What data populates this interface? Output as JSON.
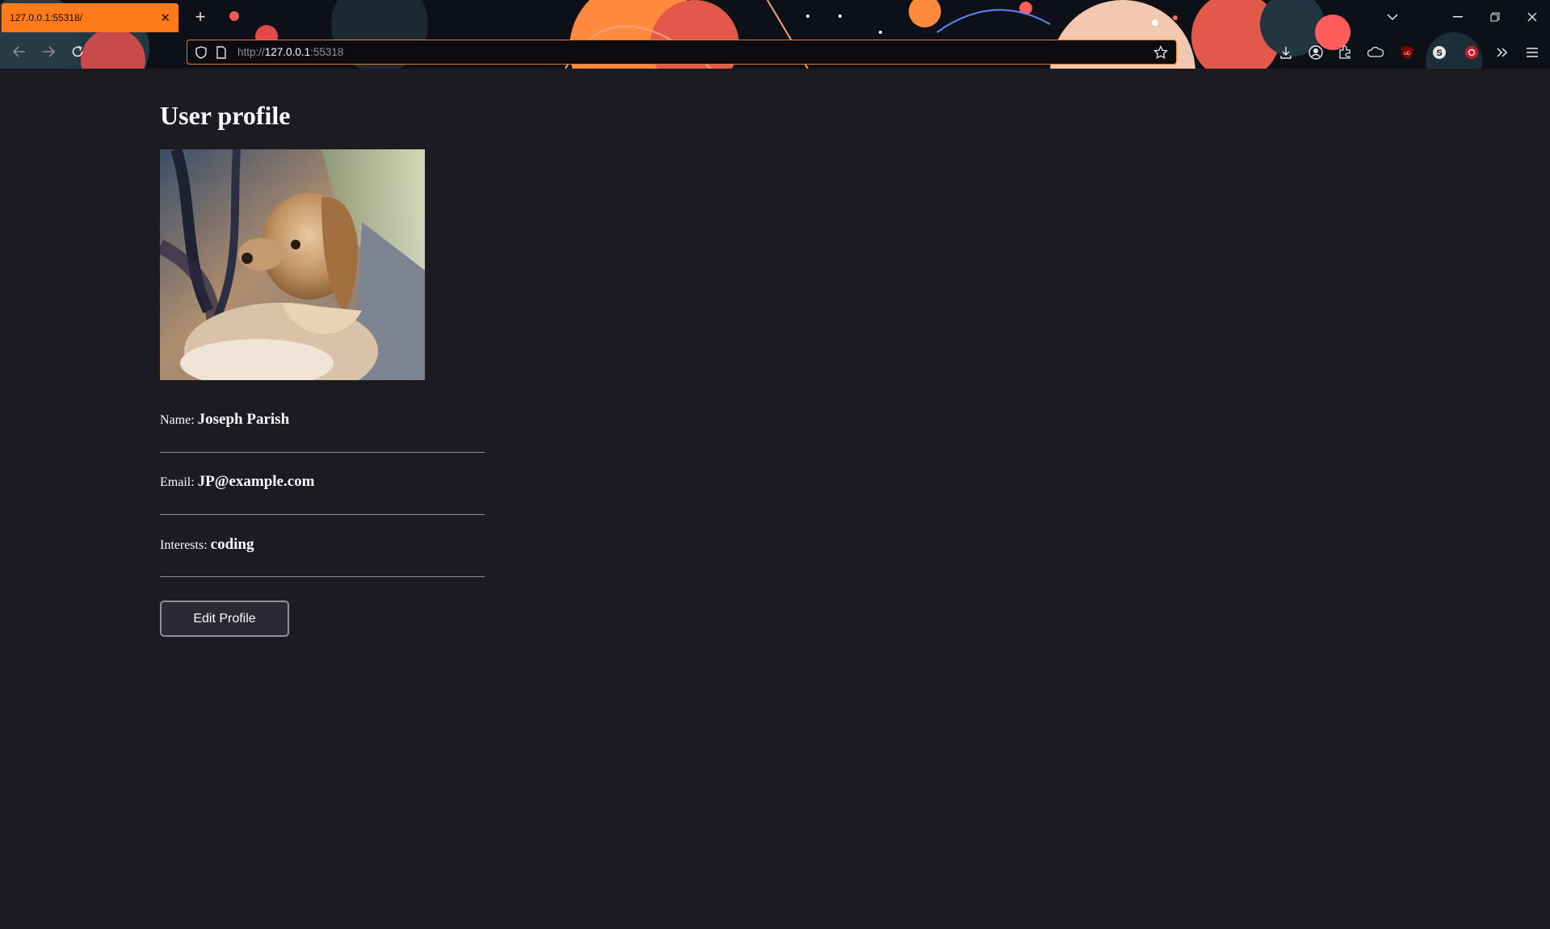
{
  "browser": {
    "tab_title": "127.0.0.1:55318/",
    "url_scheme": "http://",
    "url_host": "127.0.0.1",
    "url_port": ":55318",
    "accent_color": "#ff7a1a"
  },
  "page": {
    "title": "User profile",
    "photo_alt": "dog",
    "fields": [
      {
        "label": "Name:",
        "value": "Joseph Parish"
      },
      {
        "label": "Email:",
        "value": "JP@example.com"
      },
      {
        "label": "Interests:",
        "value": "coding"
      }
    ],
    "edit_button": "Edit Profile"
  },
  "icons": {
    "back": "back-arrow-icon",
    "forward": "forward-arrow-icon",
    "reload": "reload-icon",
    "shield": "shield-icon",
    "page": "page-icon",
    "bookmark": "star-icon",
    "downloads": "download-icon",
    "account": "account-icon",
    "extensions": "puzzle-icon",
    "menu": "hamburger-icon"
  }
}
